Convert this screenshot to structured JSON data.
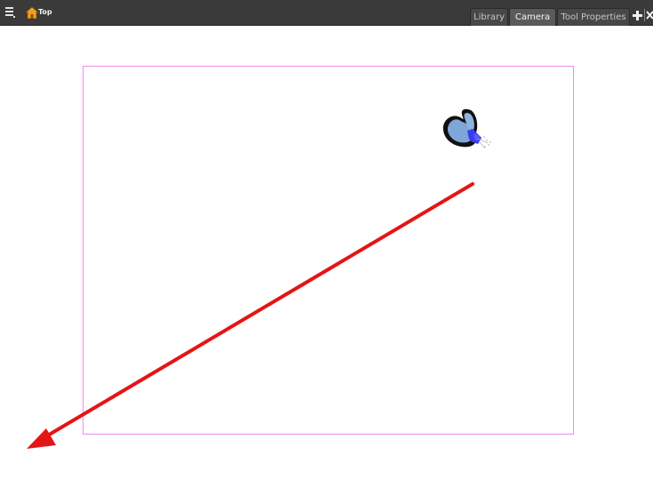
{
  "header": {
    "breadcrumb_label": "Top"
  },
  "tabs": [
    {
      "label": "Library",
      "active": false
    },
    {
      "label": "Camera",
      "active": true
    },
    {
      "label": "Tool Properties",
      "active": false
    }
  ],
  "icons": {
    "menu": "hamburger-menu-icon",
    "home": "home-icon",
    "add": "plus-icon",
    "close": "close-icon"
  },
  "colors": {
    "toolbar_background": "#3a3a3a",
    "camera_frame": "#f08cf0",
    "annotation_arrow": "#e41515",
    "butterfly_wing": "#7fa6d8",
    "butterfly_accent": "#3a3af0",
    "home_icon": "#f0a020"
  }
}
